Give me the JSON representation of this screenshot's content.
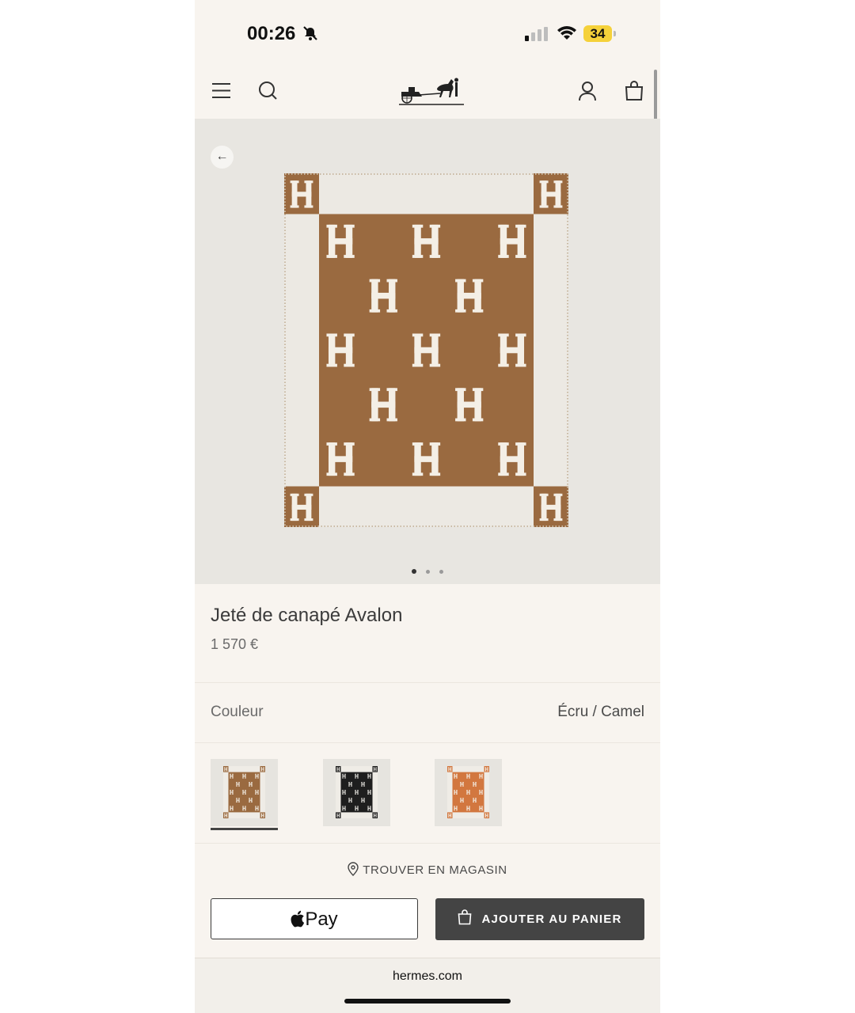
{
  "status_bar": {
    "time": "00:26",
    "battery": "34"
  },
  "header": {
    "logo_name": "hermes-carriage-logo"
  },
  "product": {
    "title": "Jeté de canapé Avalon",
    "price": "1 570 €",
    "image_count": 3,
    "active_image": 1
  },
  "color": {
    "label": "Couleur",
    "value": "Écru / Camel",
    "swatches": [
      {
        "name": "Écru / Camel",
        "field": "#9a6a40",
        "letter": "#f4efe6",
        "selected": true
      },
      {
        "name": "Black",
        "field": "#1e1e1e",
        "letter": "#e8e6e1",
        "selected": false
      },
      {
        "name": "Orange",
        "field": "#d2773f",
        "letter": "#f4efe6",
        "selected": false
      }
    ]
  },
  "actions": {
    "find_store": "TROUVER EN MAGASIN",
    "apple_pay": "Pay",
    "add_to_cart": "AJOUTER AU PANIER"
  },
  "browser": {
    "url": "hermes.com"
  },
  "colors": {
    "blanket_camel": "#9a6a40",
    "blanket_ecru": "#ece9e3",
    "button_dark": "#444444"
  }
}
